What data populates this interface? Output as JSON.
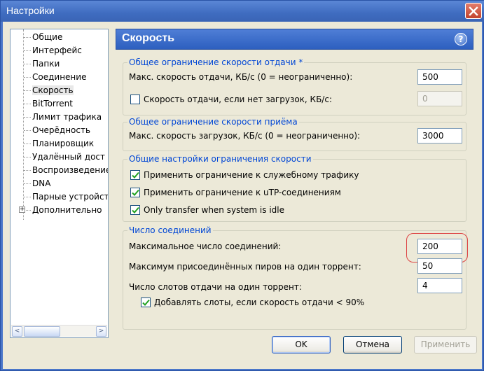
{
  "window": {
    "title": "Настройки"
  },
  "tree": {
    "items": [
      {
        "label": "Общие"
      },
      {
        "label": "Интерфейс"
      },
      {
        "label": "Папки"
      },
      {
        "label": "Соединение"
      },
      {
        "label": "Скорость"
      },
      {
        "label": "BitTorrent"
      },
      {
        "label": "Лимит трафика"
      },
      {
        "label": "Очерёдность"
      },
      {
        "label": "Планировщик"
      },
      {
        "label": "Удалённый дост"
      },
      {
        "label": "Воспроизведение"
      },
      {
        "label": "DNA"
      },
      {
        "label": "Парные устройст"
      },
      {
        "label": "Дополнительно"
      }
    ],
    "selected": "Скорость",
    "expander_symbol": "+",
    "scroll_left": "<",
    "scroll_right": ">"
  },
  "panel": {
    "title": "Скорость",
    "help_symbol": "?",
    "upload_group": {
      "legend": "Общее ограничение скорости отдачи *",
      "max_upload_label": "Макс. скорость отдачи, КБ/с (0 = неограниченно):",
      "max_upload_value": "500",
      "no_download_label": "Скорость отдачи, если нет загрузок, КБ/с:",
      "no_download_checked": false,
      "no_download_value": "0"
    },
    "download_group": {
      "legend": "Общее ограничение скорости приёма",
      "max_download_label": "Макс. скорость загрузок, КБ/с (0 = неограниченно):",
      "max_download_value": "3000"
    },
    "general_group": {
      "legend": "Общие настройки ограничения скорости",
      "overhead_label": "Применить ограничение к служебному трафику",
      "overhead_checked": true,
      "utp_label": "Применить ограничение к uTP-соединениям",
      "utp_checked": true,
      "idle_label": "Only transfer when system is idle",
      "idle_checked": true
    },
    "connections_group": {
      "legend": "Число соединений",
      "max_connections_label": "Максимальное число соединений:",
      "max_connections_value": "200",
      "max_peers_label": "Максимум присоединённых пиров на один торрент:",
      "max_peers_value": "50",
      "upload_slots_label": "Число слотов отдачи на один торрент:",
      "upload_slots_value": "4",
      "extra_slots_label": "Добавлять слоты, если скорость отдачи < 90%",
      "extra_slots_checked": true
    }
  },
  "buttons": {
    "ok": "OK",
    "cancel": "Отмена",
    "apply": "Применить"
  },
  "colors": {
    "accent": "#2d5fbf",
    "group_legend": "#0046d5",
    "highlight": "#dd4444"
  }
}
